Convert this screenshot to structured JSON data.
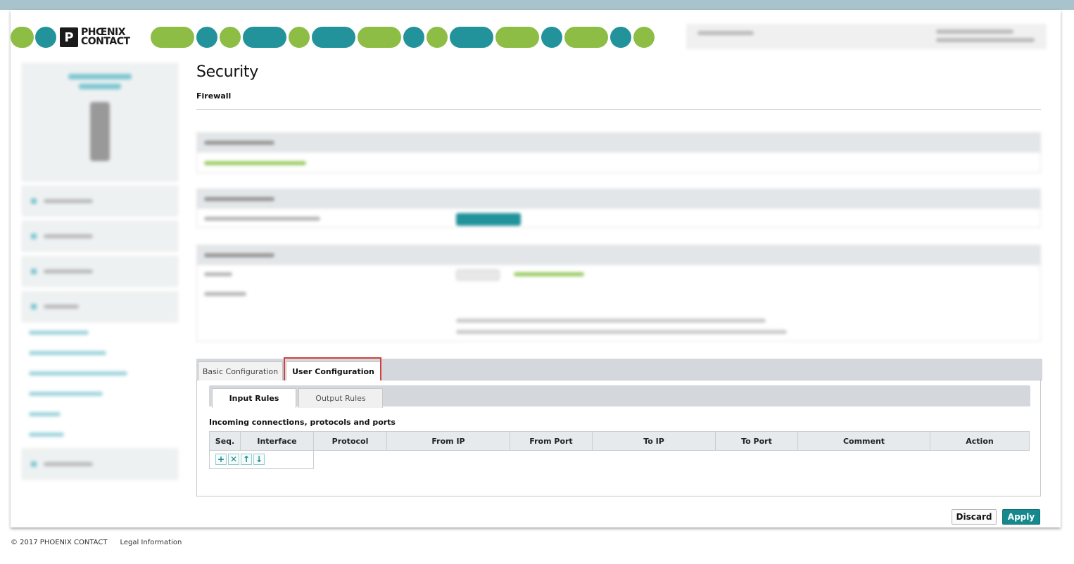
{
  "header": {
    "logo_line1": "PHŒNIX",
    "logo_line2": "CONTACT"
  },
  "main": {
    "title": "Security",
    "subtitle": "Firewall"
  },
  "tabs": {
    "basic": "Basic Configuration",
    "user": "User Configuration",
    "active": "User Configuration"
  },
  "subtabs": {
    "input": "Input Rules",
    "output": "Output Rules",
    "active": "Input Rules"
  },
  "rules": {
    "intro": "Incoming connections, protocols and ports",
    "columns": [
      "Seq.",
      "Interface",
      "Protocol",
      "From IP",
      "From Port",
      "To IP",
      "To Port",
      "Comment",
      "Action"
    ],
    "controls": [
      {
        "icon": "add-icon",
        "glyph": "+"
      },
      {
        "icon": "delete-icon",
        "glyph": "✕"
      },
      {
        "icon": "move-up-icon",
        "glyph": "↑"
      },
      {
        "icon": "move-down-icon",
        "glyph": "↓"
      }
    ]
  },
  "actions": {
    "discard": "Discard",
    "apply": "Apply"
  },
  "footer": {
    "copyright": "© 2017 PHOENIX CONTACT",
    "legal": "Legal Information"
  },
  "colors": {
    "brand_green": "#8dbd44",
    "brand_teal": "#22939b",
    "apply_button": "#16898f",
    "highlight": "#d2403f"
  }
}
